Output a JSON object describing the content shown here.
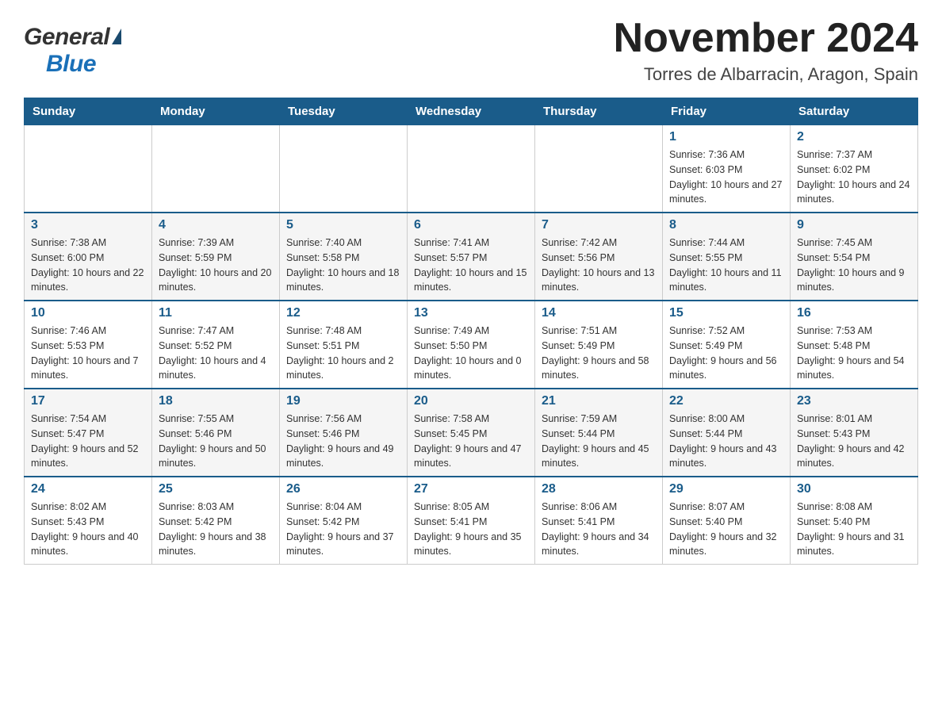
{
  "header": {
    "title": "November 2024",
    "location": "Torres de Albarracin, Aragon, Spain",
    "logo_general": "General",
    "logo_blue": "Blue"
  },
  "weekdays": [
    "Sunday",
    "Monday",
    "Tuesday",
    "Wednesday",
    "Thursday",
    "Friday",
    "Saturday"
  ],
  "weeks": [
    {
      "days": [
        {
          "date": "",
          "info": ""
        },
        {
          "date": "",
          "info": ""
        },
        {
          "date": "",
          "info": ""
        },
        {
          "date": "",
          "info": ""
        },
        {
          "date": "",
          "info": ""
        },
        {
          "date": "1",
          "info": "Sunrise: 7:36 AM\nSunset: 6:03 PM\nDaylight: 10 hours and 27 minutes."
        },
        {
          "date": "2",
          "info": "Sunrise: 7:37 AM\nSunset: 6:02 PM\nDaylight: 10 hours and 24 minutes."
        }
      ]
    },
    {
      "days": [
        {
          "date": "3",
          "info": "Sunrise: 7:38 AM\nSunset: 6:00 PM\nDaylight: 10 hours and 22 minutes."
        },
        {
          "date": "4",
          "info": "Sunrise: 7:39 AM\nSunset: 5:59 PM\nDaylight: 10 hours and 20 minutes."
        },
        {
          "date": "5",
          "info": "Sunrise: 7:40 AM\nSunset: 5:58 PM\nDaylight: 10 hours and 18 minutes."
        },
        {
          "date": "6",
          "info": "Sunrise: 7:41 AM\nSunset: 5:57 PM\nDaylight: 10 hours and 15 minutes."
        },
        {
          "date": "7",
          "info": "Sunrise: 7:42 AM\nSunset: 5:56 PM\nDaylight: 10 hours and 13 minutes."
        },
        {
          "date": "8",
          "info": "Sunrise: 7:44 AM\nSunset: 5:55 PM\nDaylight: 10 hours and 11 minutes."
        },
        {
          "date": "9",
          "info": "Sunrise: 7:45 AM\nSunset: 5:54 PM\nDaylight: 10 hours and 9 minutes."
        }
      ]
    },
    {
      "days": [
        {
          "date": "10",
          "info": "Sunrise: 7:46 AM\nSunset: 5:53 PM\nDaylight: 10 hours and 7 minutes."
        },
        {
          "date": "11",
          "info": "Sunrise: 7:47 AM\nSunset: 5:52 PM\nDaylight: 10 hours and 4 minutes."
        },
        {
          "date": "12",
          "info": "Sunrise: 7:48 AM\nSunset: 5:51 PM\nDaylight: 10 hours and 2 minutes."
        },
        {
          "date": "13",
          "info": "Sunrise: 7:49 AM\nSunset: 5:50 PM\nDaylight: 10 hours and 0 minutes."
        },
        {
          "date": "14",
          "info": "Sunrise: 7:51 AM\nSunset: 5:49 PM\nDaylight: 9 hours and 58 minutes."
        },
        {
          "date": "15",
          "info": "Sunrise: 7:52 AM\nSunset: 5:49 PM\nDaylight: 9 hours and 56 minutes."
        },
        {
          "date": "16",
          "info": "Sunrise: 7:53 AM\nSunset: 5:48 PM\nDaylight: 9 hours and 54 minutes."
        }
      ]
    },
    {
      "days": [
        {
          "date": "17",
          "info": "Sunrise: 7:54 AM\nSunset: 5:47 PM\nDaylight: 9 hours and 52 minutes."
        },
        {
          "date": "18",
          "info": "Sunrise: 7:55 AM\nSunset: 5:46 PM\nDaylight: 9 hours and 50 minutes."
        },
        {
          "date": "19",
          "info": "Sunrise: 7:56 AM\nSunset: 5:46 PM\nDaylight: 9 hours and 49 minutes."
        },
        {
          "date": "20",
          "info": "Sunrise: 7:58 AM\nSunset: 5:45 PM\nDaylight: 9 hours and 47 minutes."
        },
        {
          "date": "21",
          "info": "Sunrise: 7:59 AM\nSunset: 5:44 PM\nDaylight: 9 hours and 45 minutes."
        },
        {
          "date": "22",
          "info": "Sunrise: 8:00 AM\nSunset: 5:44 PM\nDaylight: 9 hours and 43 minutes."
        },
        {
          "date": "23",
          "info": "Sunrise: 8:01 AM\nSunset: 5:43 PM\nDaylight: 9 hours and 42 minutes."
        }
      ]
    },
    {
      "days": [
        {
          "date": "24",
          "info": "Sunrise: 8:02 AM\nSunset: 5:43 PM\nDaylight: 9 hours and 40 minutes."
        },
        {
          "date": "25",
          "info": "Sunrise: 8:03 AM\nSunset: 5:42 PM\nDaylight: 9 hours and 38 minutes."
        },
        {
          "date": "26",
          "info": "Sunrise: 8:04 AM\nSunset: 5:42 PM\nDaylight: 9 hours and 37 minutes."
        },
        {
          "date": "27",
          "info": "Sunrise: 8:05 AM\nSunset: 5:41 PM\nDaylight: 9 hours and 35 minutes."
        },
        {
          "date": "28",
          "info": "Sunrise: 8:06 AM\nSunset: 5:41 PM\nDaylight: 9 hours and 34 minutes."
        },
        {
          "date": "29",
          "info": "Sunrise: 8:07 AM\nSunset: 5:40 PM\nDaylight: 9 hours and 32 minutes."
        },
        {
          "date": "30",
          "info": "Sunrise: 8:08 AM\nSunset: 5:40 PM\nDaylight: 9 hours and 31 minutes."
        }
      ]
    }
  ]
}
